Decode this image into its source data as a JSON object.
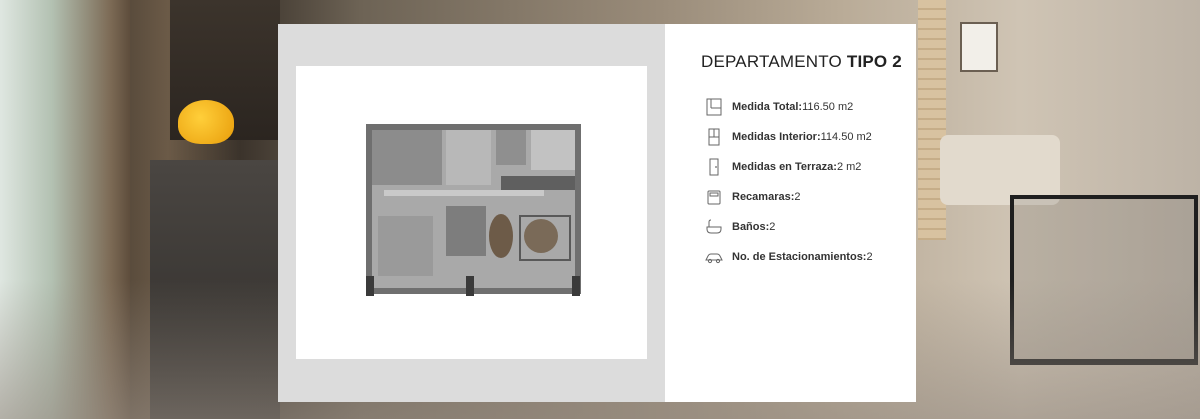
{
  "header": {
    "title_prefix": "DEPARTAMENTO ",
    "title_bold": "TIPO 2"
  },
  "specs": [
    {
      "label": "Medida Total:",
      "value": " 116.50 m2",
      "icon": "area-plan-icon"
    },
    {
      "label": "Medidas Interior:",
      "value": " 114.50 m2",
      "icon": "interior-plan-icon"
    },
    {
      "label": "Medidas en Terraza:",
      "value": " 2 m2",
      "icon": "terrace-door-icon"
    },
    {
      "label": "Recamaras:",
      "value": " 2",
      "icon": "bed-icon"
    },
    {
      "label": "Baños:",
      "value": " 2",
      "icon": "bathtub-icon"
    },
    {
      "label": "No. de Estacionamientos:",
      "value": " 2",
      "icon": "car-icon"
    }
  ],
  "colors": {
    "card_left": "#dcdcdc",
    "card_right": "#ffffff",
    "text": "#222222"
  }
}
